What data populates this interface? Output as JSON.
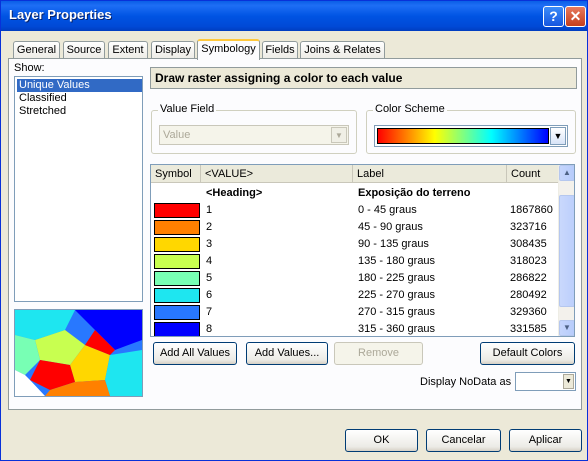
{
  "window": {
    "title": "Layer Properties"
  },
  "tabs": [
    {
      "label": "General"
    },
    {
      "label": "Source"
    },
    {
      "label": "Extent"
    },
    {
      "label": "Display"
    },
    {
      "label": "Symbology",
      "active": true
    },
    {
      "label": "Fields"
    },
    {
      "label": "Joins & Relates"
    }
  ],
  "show": {
    "label": "Show:",
    "items": [
      {
        "label": "Unique Values",
        "selected": true
      },
      {
        "label": "Classified"
      },
      {
        "label": "Stretched"
      }
    ]
  },
  "description": "Draw raster assigning a color to each value",
  "value_field": {
    "label": "Value Field",
    "value": "Value"
  },
  "color_scheme": {
    "label": "Color Scheme"
  },
  "grid": {
    "headers": {
      "symbol": "Symbol",
      "value": "<VALUE>",
      "label": "Label",
      "count": "Count"
    },
    "heading": {
      "value": "<Heading>",
      "label": "Exposição do terreno"
    },
    "rows": [
      {
        "color": "#ff0000",
        "value": "1",
        "label": "0 - 45 graus",
        "count": "1867860"
      },
      {
        "color": "#ff8000",
        "value": "2",
        "label": "45 - 90 graus",
        "count": "323716"
      },
      {
        "color": "#ffd700",
        "value": "3",
        "label": "90 - 135 graus",
        "count": "308435"
      },
      {
        "color": "#c8ff50",
        "value": "4",
        "label": "135 - 180 graus",
        "count": "318023"
      },
      {
        "color": "#78ffb4",
        "value": "5",
        "label": "180 - 225 graus",
        "count": "286822"
      },
      {
        "color": "#1ee6f0",
        "value": "6",
        "label": "225 - 270 graus",
        "count": "280492"
      },
      {
        "color": "#2878ff",
        "value": "7",
        "label": "270 - 315 graus",
        "count": "329360"
      },
      {
        "color": "#0000ff",
        "value": "8",
        "label": "315 - 360 graus",
        "count": "331585"
      }
    ]
  },
  "buttons": {
    "add_all": "Add All Values",
    "add_values": "Add Values...",
    "remove": "Remove",
    "default_colors": "Default Colors",
    "ok": "OK",
    "cancel": "Cancelar",
    "apply": "Aplicar"
  },
  "nodata": {
    "label": "Display NoData as"
  }
}
